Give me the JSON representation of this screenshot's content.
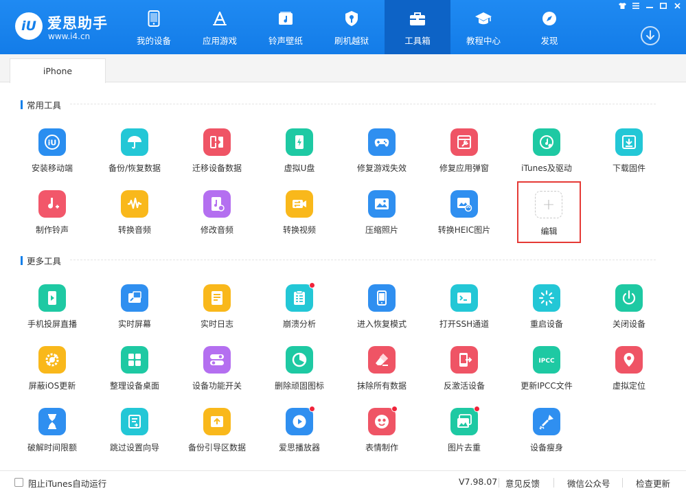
{
  "app": {
    "logo_mark": "iU",
    "name": "爱思助手",
    "url": "www.i4.cn"
  },
  "nav": [
    {
      "label": "我的设备",
      "icon": "phone-icon"
    },
    {
      "label": "应用游戏",
      "icon": "appstore-icon"
    },
    {
      "label": "铃声壁纸",
      "icon": "music-folder-icon"
    },
    {
      "label": "刷机越狱",
      "icon": "shield-key-icon"
    },
    {
      "label": "工具箱",
      "icon": "toolbox-icon",
      "active": true
    },
    {
      "label": "教程中心",
      "icon": "graduation-cap-icon"
    },
    {
      "label": "发现",
      "icon": "compass-icon"
    }
  ],
  "window_controls": [
    "shirt-icon",
    "menu-icon",
    "minimize-icon",
    "maximize-icon",
    "close-icon"
  ],
  "tabs": [
    {
      "label": "iPhone"
    }
  ],
  "sections": {
    "common": {
      "title": "常用工具",
      "tools": [
        {
          "label": "安装移动端",
          "icon": "i4-app-icon",
          "color": "#2a8ef0"
        },
        {
          "label": "备份/恢复数据",
          "icon": "umbrella-icon",
          "color": "#23c7d6"
        },
        {
          "label": "迁移设备数据",
          "icon": "transfer-icon",
          "color": "#ef5465"
        },
        {
          "label": "虚拟U盘",
          "icon": "usb-drive-icon",
          "color": "#1ec9a3"
        },
        {
          "label": "修复游戏失效",
          "icon": "gamepad-icon",
          "color": "#2f8ff0"
        },
        {
          "label": "修复应用弹窗",
          "icon": "app-repair-icon",
          "color": "#ef5465"
        },
        {
          "label": "iTunes及驱动",
          "icon": "itunes-icon",
          "color": "#1ec9a3"
        },
        {
          "label": "下载固件",
          "icon": "firmware-download-icon",
          "color": "#23c7d6"
        },
        {
          "label": "制作铃声",
          "icon": "ringtone-icon",
          "color": "#f2576a"
        },
        {
          "label": "转换音频",
          "icon": "waveform-icon",
          "color": "#f9b81b"
        },
        {
          "label": "修改音频",
          "icon": "audio-edit-icon",
          "color": "#b46ff0"
        },
        {
          "label": "转换视频",
          "icon": "video-convert-icon",
          "color": "#f9b81b"
        },
        {
          "label": "压缩照片",
          "icon": "photo-compress-icon",
          "color": "#2f8ff0"
        },
        {
          "label": "转换HEIC图片",
          "icon": "heic-convert-icon",
          "color": "#2f8ff0"
        }
      ],
      "edit_label": "编辑"
    },
    "more": {
      "title": "更多工具",
      "tools": [
        {
          "label": "手机投屏直播",
          "icon": "screen-cast-icon",
          "color": "#1ec9a3"
        },
        {
          "label": "实时屏幕",
          "icon": "live-screen-icon",
          "color": "#2f8ff0"
        },
        {
          "label": "实时日志",
          "icon": "log-icon",
          "color": "#f9b81b"
        },
        {
          "label": "崩溃分析",
          "icon": "crash-analysis-icon",
          "color": "#23c7d6",
          "badge": true
        },
        {
          "label": "进入恢复模式",
          "icon": "recovery-mode-icon",
          "color": "#2f8ff0"
        },
        {
          "label": "打开SSH通道",
          "icon": "terminal-icon",
          "color": "#23c7d6"
        },
        {
          "label": "重启设备",
          "icon": "restart-icon",
          "color": "#23c7d6"
        },
        {
          "label": "关闭设备",
          "icon": "power-icon",
          "color": "#1ec9a3"
        },
        {
          "label": "屏蔽iOS更新",
          "icon": "block-update-icon",
          "color": "#f9b81b"
        },
        {
          "label": "整理设备桌面",
          "icon": "grid-icon",
          "color": "#1ec9a3"
        },
        {
          "label": "设备功能开关",
          "icon": "toggle-icon",
          "color": "#b46ff0"
        },
        {
          "label": "删除顽固图标",
          "icon": "pie-delete-icon",
          "color": "#1ec9a3"
        },
        {
          "label": "抹除所有数据",
          "icon": "eraser-icon",
          "color": "#ef5465"
        },
        {
          "label": "反激活设备",
          "icon": "deactivate-icon",
          "color": "#ef5465"
        },
        {
          "label": "更新IPCC文件",
          "icon": "ipcc-icon",
          "color": "#1ec9a3",
          "text": "IPCC"
        },
        {
          "label": "虚拟定位",
          "icon": "location-pin-icon",
          "color": "#ef5465"
        },
        {
          "label": "破解时间限额",
          "icon": "hourglass-icon",
          "color": "#2f8ff0"
        },
        {
          "label": "跳过设置向导",
          "icon": "skip-wizard-icon",
          "color": "#23c7d6"
        },
        {
          "label": "备份引导区数据",
          "icon": "boot-backup-icon",
          "color": "#f9b81b"
        },
        {
          "label": "爱思播放器",
          "icon": "play-icon",
          "color": "#2f8ff0",
          "badge": true
        },
        {
          "label": "表情制作",
          "icon": "emoji-icon",
          "color": "#ef5465",
          "badge": true
        },
        {
          "label": "图片去重",
          "icon": "photo-dedupe-icon",
          "color": "#1ec9a3",
          "badge": true
        },
        {
          "label": "设备瘦身",
          "icon": "broom-icon",
          "color": "#2f8ff0"
        }
      ]
    }
  },
  "footer": {
    "checkbox_label": "阻止iTunes自动运行",
    "version": "V7.98.07",
    "feedback": "意见反馈",
    "wechat": "微信公众号",
    "update": "检查更新"
  }
}
